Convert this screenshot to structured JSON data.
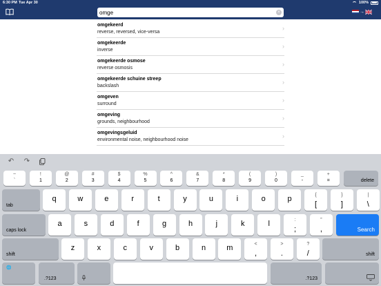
{
  "status": {
    "time": "6:30 PM",
    "date": "Tue Apr 30",
    "battery": "100%"
  },
  "search": {
    "value": "omge"
  },
  "results": [
    {
      "word": "omgekeerd",
      "translation": "reverse, reversed, vice-versa"
    },
    {
      "word": "omgekeerde",
      "translation": "inverse"
    },
    {
      "word": "omgekeerde osmose",
      "translation": "reverse osmosis"
    },
    {
      "word": "omgekeerde schuine streep",
      "translation": "backslash"
    },
    {
      "word": "omgeven",
      "translation": "surround"
    },
    {
      "word": "omgeving",
      "translation": "grounds, neighbourhood"
    },
    {
      "word": "omgevingsgeluid",
      "translation": "environmental noise, neighbourhood noise"
    }
  ],
  "keyboard": {
    "number_row": [
      {
        "top": "~",
        "bottom": "`"
      },
      {
        "top": "!",
        "bottom": "1"
      },
      {
        "top": "@",
        "bottom": "2"
      },
      {
        "top": "#",
        "bottom": "3"
      },
      {
        "top": "$",
        "bottom": "4"
      },
      {
        "top": "%",
        "bottom": "5"
      },
      {
        "top": "^",
        "bottom": "6"
      },
      {
        "top": "&",
        "bottom": "7"
      },
      {
        "top": "*",
        "bottom": "8"
      },
      {
        "top": "(",
        "bottom": "9"
      },
      {
        "top": ")",
        "bottom": "0"
      },
      {
        "top": "_",
        "bottom": "-"
      },
      {
        "top": "+",
        "bottom": "="
      }
    ],
    "delete_label": "delete",
    "tab_label": "tab",
    "row_q": [
      "q",
      "w",
      "e",
      "r",
      "t",
      "y",
      "u",
      "i",
      "o",
      "p"
    ],
    "row_q_extra": [
      {
        "top": "{",
        "bottom": "["
      },
      {
        "top": "}",
        "bottom": "]"
      },
      {
        "top": "|",
        "bottom": "\\"
      }
    ],
    "caps_label": "caps lock",
    "row_a": [
      "a",
      "s",
      "d",
      "f",
      "g",
      "h",
      "j",
      "k",
      "l"
    ],
    "row_a_extra": [
      {
        "top": ":",
        "bottom": ";"
      },
      {
        "top": "”",
        "bottom": ","
      }
    ],
    "search_label": "Search",
    "shift_label": "shift",
    "row_z": [
      "z",
      "x",
      "c",
      "v",
      "b",
      "n",
      "m"
    ],
    "row_z_extra": [
      {
        "top": "<",
        "bottom": ","
      },
      {
        "top": ">",
        "bottom": "."
      },
      {
        "top": "?",
        "bottom": "/"
      }
    ],
    "num_label": ".?123"
  },
  "colors": {
    "header": "#1f3a6e",
    "search_key": "#1a7cf5",
    "keyboard_bg": "#d1d4d9"
  },
  "icons": [
    "book-icon",
    "clear-icon",
    "language-toggle-icon",
    "undo-icon",
    "redo-icon",
    "paste-icon",
    "microphone-icon",
    "keyboard-dismiss-icon",
    "chevron-right-icon"
  ]
}
